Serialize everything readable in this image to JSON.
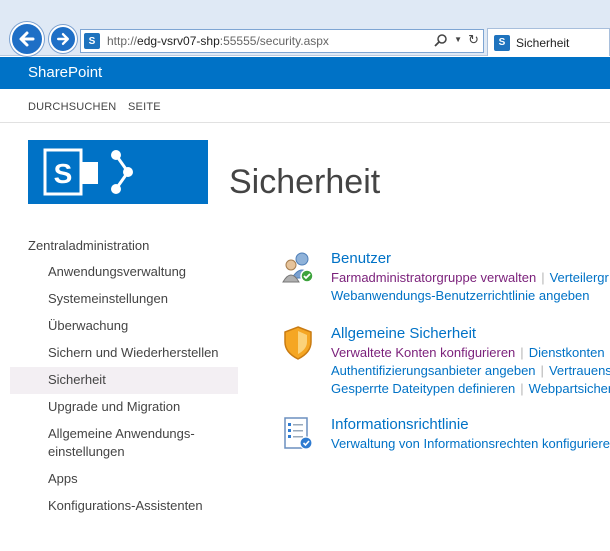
{
  "browser": {
    "url_prefix": "http://",
    "url_host": "edg-vsrv07-shp",
    "url_rest": ":55555/security.aspx",
    "tab_title": "Sicherheit"
  },
  "suitebar": {
    "brand": "SharePoint"
  },
  "ribbon": {
    "tabs": [
      "DURCHSUCHEN",
      "SEITE"
    ]
  },
  "page": {
    "title": "Sicherheit"
  },
  "leftnav": {
    "root": "Zentraladministration",
    "items": [
      "Anwendungsverwaltung",
      "Systemeinstellungen",
      "Überwachung",
      "Sichern und Wiederherstellen",
      "Sicherheit",
      "Upgrade und Migration",
      "Allgemeine Anwendungs-einstellungen",
      "Apps",
      "Konfigurations-Assistenten"
    ],
    "items_line1": [
      "Allgemeine Anwendungs-"
    ],
    "items_line2": [
      "einstellungen"
    ],
    "selected": "Sicherheit"
  },
  "sections": [
    {
      "title": "Benutzer",
      "icon": "users-icon",
      "lines": [
        [
          "Farmadministratorgruppe verwalten",
          "Verteilergr"
        ],
        [
          "Webanwendungs-Benutzerrichtlinie angeben"
        ]
      ]
    },
    {
      "title": "Allgemeine Sicherheit",
      "icon": "shield-icon",
      "lines": [
        [
          "Verwaltete Konten konfigurieren",
          "Dienstkonten"
        ],
        [
          "Authentifizierungsanbieter angeben",
          "Vertrauens"
        ],
        [
          "Gesperrte Dateitypen definieren",
          "Webpartsicher"
        ]
      ]
    },
    {
      "title": "Informationsrichtlinie",
      "icon": "policy-icon",
      "lines": [
        [
          "Verwaltung von Informationsrechten konfigurieren"
        ]
      ]
    }
  ],
  "colors": {
    "brand": "#0072c6",
    "visited_link": "#7a1f7a",
    "selected_nav_bg": "#f3eff3"
  }
}
